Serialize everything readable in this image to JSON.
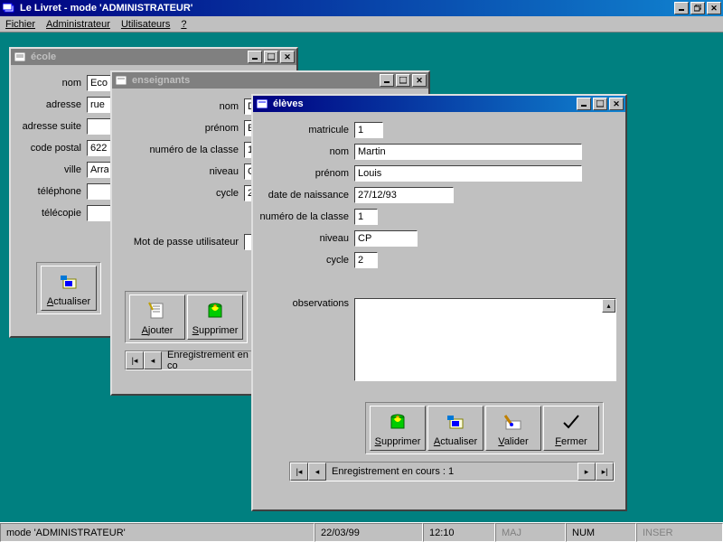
{
  "app": {
    "title": "Le Livret - mode 'ADMINISTRATEUR'"
  },
  "menu": {
    "fichier": "Fichier",
    "admin": "Administrateur",
    "users": "Utilisateurs",
    "help": "?"
  },
  "windows": {
    "ecole": {
      "title": "école",
      "labels": {
        "nom": "nom",
        "adresse": "adresse",
        "adresse2": "adresse suite",
        "cp": "code postal",
        "ville": "ville",
        "tel": "téléphone",
        "fax": "télécopie"
      },
      "values": {
        "nom": "Eco",
        "adresse": "rue",
        "adresse2": "",
        "cp": "622",
        "ville": "Arra",
        "tel": "",
        "fax": ""
      },
      "btn_actualiser": "Actualiser"
    },
    "ens": {
      "title": "enseignants",
      "labels": {
        "nom": "nom",
        "prenom": "prénom",
        "classe": "numéro de la classe",
        "niveau": "niveau",
        "cycle": "cycle",
        "mdp": "Mot de passe utilisateur"
      },
      "values": {
        "nom": "Dura",
        "prenom": "Erne",
        "classe": "1",
        "niveau": "CP",
        "cycle": "2",
        "mdp": ""
      },
      "btn_ajouter": "Ajouter",
      "btn_supprimer": "Supprimer",
      "nav": "Enregistrement en co"
    },
    "elv": {
      "title": "élèves",
      "labels": {
        "matricule": "matricule",
        "nom": "nom",
        "prenom": "prénom",
        "dob": "date de naissance",
        "classe": "numéro de la classe",
        "niveau": "niveau",
        "cycle": "cycle",
        "obs": "observations"
      },
      "values": {
        "matricule": "1",
        "nom": "Martin",
        "prenom": "Louis",
        "dob": "27/12/93",
        "classe": "1",
        "niveau": "CP",
        "cycle": "2",
        "obs": ""
      },
      "btn_supprimer": "Supprimer",
      "btn_actualiser": "Actualiser",
      "btn_valider": "Valider",
      "btn_fermer": "Fermer",
      "nav": "Enregistrement en cours : 1"
    }
  },
  "statusbar": {
    "mode": "mode 'ADMINISTRATEUR'",
    "date": "22/03/99",
    "time": "12:10",
    "maj": "MAJ",
    "num": "NUM",
    "inser": "INSER"
  }
}
